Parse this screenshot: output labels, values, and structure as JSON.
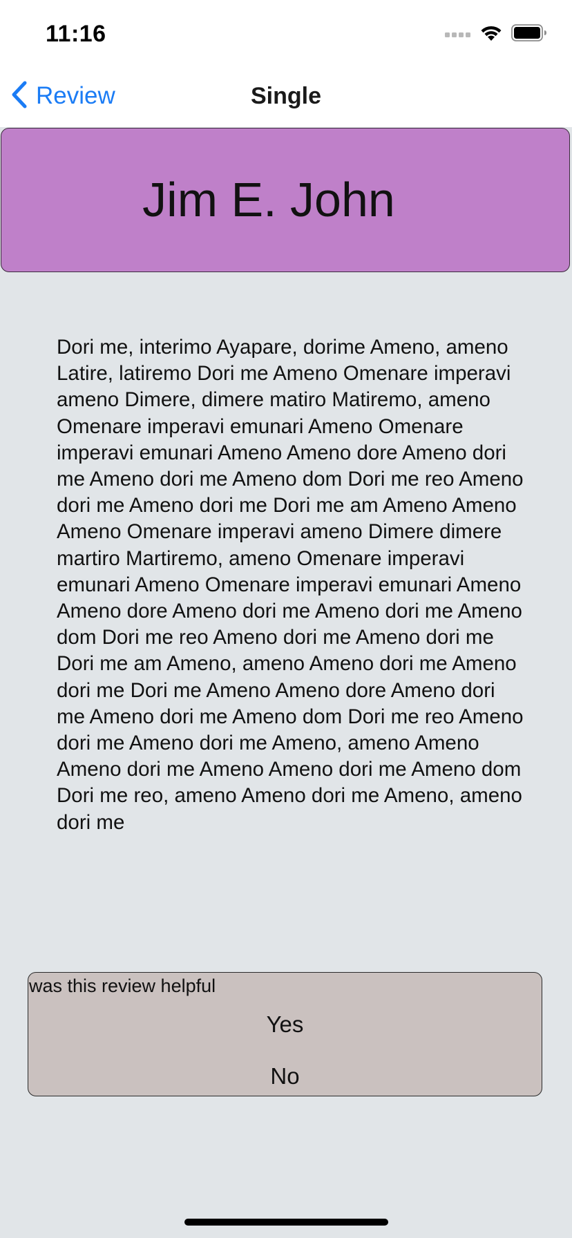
{
  "status_bar": {
    "time": "11:16"
  },
  "nav": {
    "back_label": "Review",
    "title": "Single"
  },
  "header": {
    "name": "Jim E. John",
    "background_color": "#bf80c9"
  },
  "review": {
    "text": "Dori me, interimo Ayapare, dorime Ameno, ameno Latire, latiremo Dori me Ameno Omenare imperavi ameno Dimere, dimere matiro Matiremo, ameno Omenare imperavi emunari Ameno Omenare imperavi emunari Ameno Ameno dore Ameno dori me Ameno dori me Ameno dom Dori me reo Ameno dori me Ameno dori me Dori me am Ameno Ameno Ameno Omenare imperavi ameno Dimere dimere martiro Martiremo, ameno Omenare imperavi emunari Ameno Omenare imperavi emunari Ameno Ameno dore Ameno dori me Ameno dori me Ameno dom Dori me reo Ameno dori me Ameno dori me Dori me am Ameno, ameno Ameno dori me Ameno dori me Dori me Ameno Ameno dore Ameno dori me Ameno dori me Ameno dom Dori me reo Ameno dori me Ameno dori me Ameno, ameno Ameno Ameno dori me Ameno Ameno dori me Ameno dom Dori me reo, ameno Ameno dori me Ameno, ameno dori me"
  },
  "feedback": {
    "question": "was this review helpful",
    "yes_label": "Yes",
    "no_label": "No",
    "background_color": "#cac1bf"
  },
  "icons": {
    "signal": "cellular-signal-icon",
    "wifi": "wifi-icon",
    "battery": "battery-icon",
    "back": "chevron-left-icon"
  },
  "colors": {
    "accent": "#1b7cf5",
    "page_background": "#e1e5e8"
  }
}
